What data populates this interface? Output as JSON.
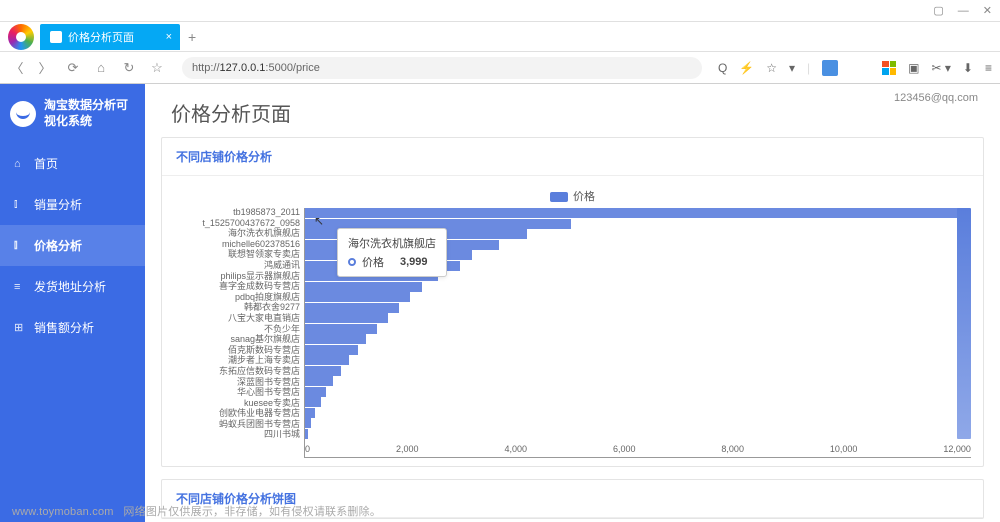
{
  "browser": {
    "tab_title": "价格分析页面",
    "url_prefix": "http://",
    "url_host": "127.0.0.1",
    "url_path": ":5000/price",
    "window_controls": {
      "restore": "▢",
      "minimize": "—",
      "close": "✕"
    }
  },
  "app": {
    "brand_line1": "淘宝数据分析可",
    "brand_line2": "视化系统",
    "user_email": "123456@qq.com",
    "nav": [
      {
        "label": "首页",
        "active": false,
        "icon": "⌂"
      },
      {
        "label": "销量分析",
        "active": false,
        "icon": "⫾"
      },
      {
        "label": "价格分析",
        "active": true,
        "icon": "⫾"
      },
      {
        "label": "发货地址分析",
        "active": false,
        "icon": "≡"
      },
      {
        "label": "销售额分析",
        "active": false,
        "icon": "⊞"
      }
    ]
  },
  "page": {
    "title": "价格分析页面",
    "card1_title": "不同店铺价格分析",
    "card2_title": "不同店铺价格分析饼图",
    "legend_label": "价格"
  },
  "tooltip": {
    "shop": "海尔洗衣机旗舰店",
    "series": "价格",
    "value": "3,999"
  },
  "chart_data": {
    "type": "bar",
    "orientation": "horizontal",
    "title": "不同店铺价格分析",
    "xlabel": "",
    "ylabel": "",
    "xlim": [
      0,
      12000
    ],
    "xticks": [
      0,
      2000,
      4000,
      6000,
      8000,
      10000,
      12000
    ],
    "series_name": "价格",
    "categories": [
      "tb1985873_2011",
      "t_1525700437672_0958",
      "海尔洗衣机旗舰店",
      "michelle602378516",
      "联想智领家专卖店",
      "鸿威通讯",
      "philips显示器旗舰店",
      "喜字金成数码专营店",
      "pdbq拍度旗舰店",
      "韩都衣舍9277",
      "八宝大家电直销店",
      "不负少年",
      "sanag基尔旗舰店",
      "佰克斯数码专营店",
      "潮步者上海专卖店",
      "东拓应信数码专营店",
      "深蓝图书专营店",
      "华心图书专营店",
      "kuesee专卖店",
      "创欧伟业电器专营店",
      "蚂蚁兵团图书专营店",
      "四川书城"
    ],
    "values": [
      11800,
      4800,
      3999,
      3500,
      3000,
      2800,
      2400,
      2100,
      1900,
      1700,
      1500,
      1300,
      1100,
      950,
      800,
      650,
      500,
      380,
      280,
      180,
      100,
      50
    ],
    "note": "Rightmost tall bar ~12000 truncated on axis"
  },
  "footer": {
    "watermark": "www.toymoban.com",
    "note": "网络图片仅供展示，非存储，如有侵权请联系删除。"
  }
}
